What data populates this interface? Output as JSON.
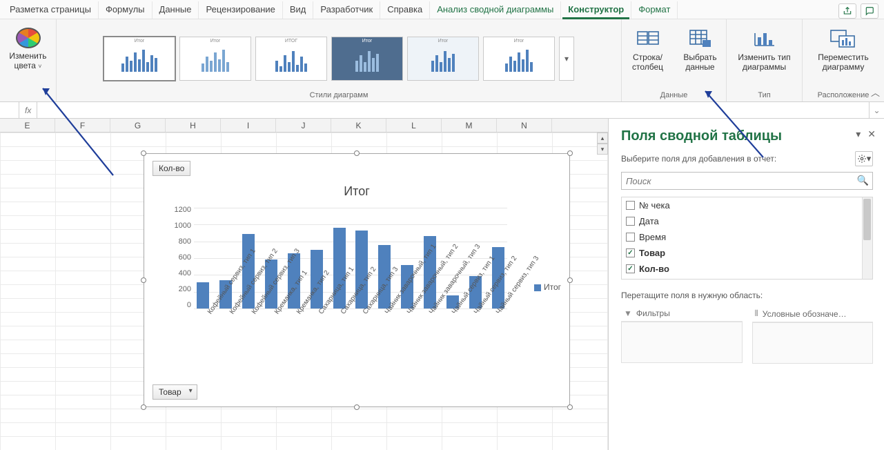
{
  "tabs": {
    "page_layout": "Разметка страницы",
    "formulas": "Формулы",
    "data": "Данные",
    "review": "Рецензирование",
    "view": "Вид",
    "developer": "Разработчик",
    "help": "Справка",
    "pivotchart_analyze": "Анализ сводной диаграммы",
    "design": "Конструктор",
    "format": "Формат"
  },
  "ribbon": {
    "change_colors": "Изменить цвета",
    "styles_group": "Стили диаграмм",
    "switch_rowcol": "Строка/ столбец",
    "select_data": "Выбрать данные",
    "data_group": "Данные",
    "change_chart_type": "Изменить тип диаграммы",
    "type_group": "Тип",
    "move_chart": "Переместить диаграмму",
    "location_group": "Расположение"
  },
  "formula_bar": {
    "fx": "fx"
  },
  "columns": [
    "E",
    "F",
    "G",
    "H",
    "I",
    "J",
    "K",
    "L",
    "M",
    "N"
  ],
  "chart_buttons": {
    "kolvo": "Кол-во",
    "tovar": "Товар"
  },
  "legend_label": "Итог",
  "chart_data": {
    "type": "bar",
    "title": "Итог",
    "ylabel": "",
    "xlabel": "",
    "ylim": [
      0,
      1200
    ],
    "yticks": [
      0,
      200,
      400,
      600,
      800,
      1000,
      1200
    ],
    "categories": [
      "Кофейный сервиз, тип 1",
      "Кофейный сервиз, тип 2",
      "Кофейный сервиз, тип 3",
      "Креманка, тип 1",
      "Креманка, тип 2",
      "Сахарница, тип 1",
      "Сахарница, тип 2",
      "Сахарница, тип 3",
      "Чайник заварочный, тип 1",
      "Чайник заварочный, тип 2",
      "Чайник заварочный, тип 3",
      "Чайный сервиз, тип 1",
      "Чайный сервиз, тип 2",
      "Чайный сервиз, тип 3"
    ],
    "values": [
      310,
      340,
      890,
      580,
      660,
      700,
      960,
      930,
      760,
      520,
      860,
      160,
      390,
      730
    ],
    "series_name": "Итог"
  },
  "task_pane": {
    "title": "Поля сводной таблицы",
    "subtitle": "Выберите поля для добавления в отчет:",
    "search_placeholder": "Поиск",
    "fields": [
      {
        "label": "№ чека",
        "checked": false
      },
      {
        "label": "Дата",
        "checked": false
      },
      {
        "label": "Время",
        "checked": false
      },
      {
        "label": "Товар",
        "checked": true
      },
      {
        "label": "Кол-во",
        "checked": true
      }
    ],
    "drag_label": "Перетащите поля в нужную область:",
    "filters_label": "Фильтры",
    "legend_label": "Условные обозначе…"
  }
}
